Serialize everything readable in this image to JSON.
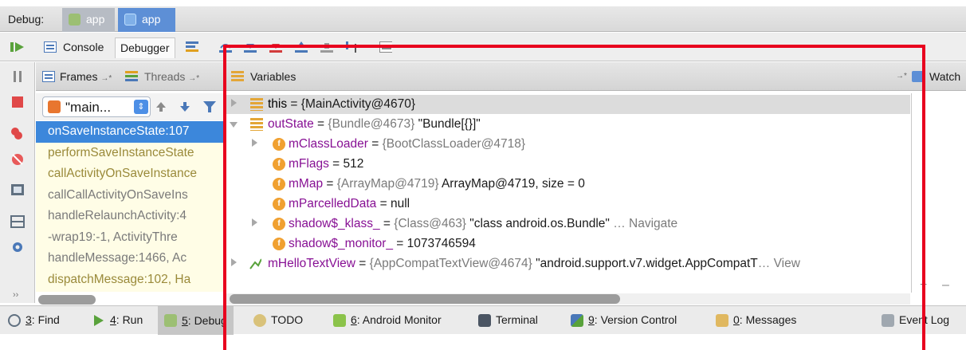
{
  "debug_bar": {
    "label": "Debug:",
    "tabs": [
      {
        "label": "app"
      },
      {
        "label": "app"
      }
    ]
  },
  "toolbar": {
    "console_label": "Console",
    "debugger_label": "Debugger"
  },
  "frames_panel": {
    "frames_tab": "Frames",
    "threads_tab": "Threads",
    "tab_suffix": "→*",
    "thread_selector": "\"main...",
    "frames": [
      "onSaveInstanceState:107",
      "performSaveInstanceState",
      "callActivityOnSaveInstance",
      "callCallActivityOnSaveIns",
      "handleRelaunchActivity:4",
      "-wrap19:-1, ActivityThre",
      "handleMessage:1466, Ac",
      "dispatchMessage:102, Ha"
    ]
  },
  "variables_panel": {
    "title": "Variables",
    "watches_label": "Watch",
    "rows": [
      {
        "name": "this",
        "eq": " = ",
        "value": "{MainActivity@4670}"
      },
      {
        "name": "outState",
        "eq": " = ",
        "value": "{Bundle@4673}",
        "extra": " \"Bundle[{}]\""
      },
      {
        "name": "mClassLoader",
        "eq": " = ",
        "value": "{BootClassLoader@4718}"
      },
      {
        "name": "mFlags",
        "eq": " = ",
        "value": "512"
      },
      {
        "name": "mMap",
        "eq": " = ",
        "value": "{ArrayMap@4719}",
        "extra": " ArrayMap@4719, size = 0"
      },
      {
        "name": "mParcelledData",
        "eq": " = ",
        "value": "null"
      },
      {
        "name": "shadow$_klass_",
        "eq": " = ",
        "value": "{Class@463}",
        "extra": " \"class android.os.Bundle\"",
        "link": " … Navigate"
      },
      {
        "name": "shadow$_monitor_",
        "eq": " = ",
        "value": "1073746594"
      },
      {
        "name": "mHelloTextView",
        "eq": " = ",
        "value": "{AppCompatTextView@4674}",
        "extra": " \"android.support.v7.widget.AppCompatT",
        "link": "… View"
      }
    ]
  },
  "bottom_bar": [
    {
      "key": "3",
      "label": ": Find"
    },
    {
      "key": "4",
      "label": ": Run"
    },
    {
      "key": "5",
      "label": ": Debug"
    },
    {
      "key": "",
      "label": "TODO"
    },
    {
      "key": "6",
      "label": ": Android Monitor"
    },
    {
      "key": "",
      "label": "Terminal"
    },
    {
      "key": "9",
      "label": ": Version Control"
    },
    {
      "key": "0",
      "label": ": Messages"
    },
    {
      "key": "",
      "label": "Event Log"
    }
  ],
  "colors": {
    "accent": "#3c87db",
    "annotation": "#e8001e",
    "frames_bg": "#fffde6"
  }
}
